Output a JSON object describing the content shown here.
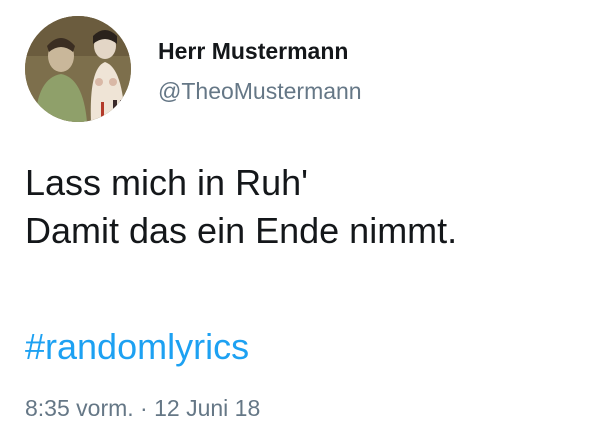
{
  "author": {
    "display_name": "Herr Mustermann",
    "handle": "@TheoMustermann",
    "avatar_icon": "profile-avatar"
  },
  "tweet": {
    "lines": [
      "Lass mich in Ruh'",
      "Damit das ein Ende nimmt."
    ],
    "hashtag": "#randomlyrics",
    "time": "8:35 vorm.",
    "separator": "·",
    "date": "12 Juni 18"
  },
  "colors": {
    "text": "#14171a",
    "secondary": "#657786",
    "link": "#1da1f2",
    "background": "#ffffff"
  }
}
